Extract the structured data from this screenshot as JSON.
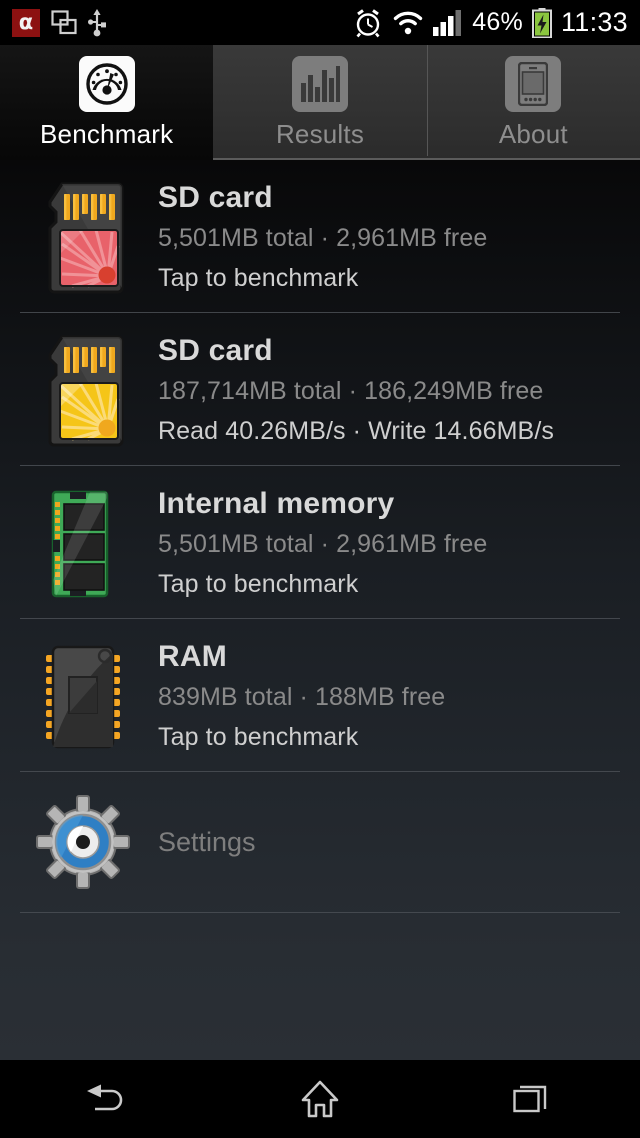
{
  "statusbar": {
    "icons_left": [
      "avira-shield-icon",
      "screenshot-icon",
      "usb-icon"
    ],
    "avira_glyph": "α",
    "icons_right": [
      "alarm-icon",
      "wifi-icon",
      "signal-icon",
      "battery-charging-icon"
    ],
    "battery_percent": "46%",
    "time": "11:33"
  },
  "tabs": [
    {
      "label": "Benchmark",
      "icon": "gauge-icon",
      "active": true
    },
    {
      "label": "Results",
      "icon": "bar-chart-icon",
      "active": false
    },
    {
      "label": "About",
      "icon": "phone-icon",
      "active": false
    }
  ],
  "list": [
    {
      "title": "SD card",
      "subtitle": "5,501MB total · 2,961MB free",
      "status": "Tap to benchmark",
      "icon": "sd-card-red-icon"
    },
    {
      "title": "SD card",
      "subtitle": "187,714MB total · 186,249MB free",
      "status": "Read 40.26MB/s · Write 14.66MB/s",
      "icon": "sd-card-yellow-icon"
    },
    {
      "title": "Internal memory",
      "subtitle": "5,501MB total · 2,961MB free",
      "status": "Tap to benchmark",
      "icon": "memory-module-green-icon"
    },
    {
      "title": "RAM",
      "subtitle": "839MB total · 188MB free",
      "status": "Tap to benchmark",
      "icon": "ram-chip-icon"
    }
  ],
  "settings": {
    "label": "Settings",
    "icon": "gear-icon"
  },
  "navbar": {
    "back_label": "Back",
    "home_label": "Home",
    "recents_label": "Recents"
  },
  "colors": {
    "accent_red": "#8c1111",
    "sd_red": "#e8626a",
    "sd_yellow": "#f5c518",
    "memory_green": "#3faa57",
    "gear_blue": "#2f7fc4",
    "battery_green": "#8bc53f"
  }
}
